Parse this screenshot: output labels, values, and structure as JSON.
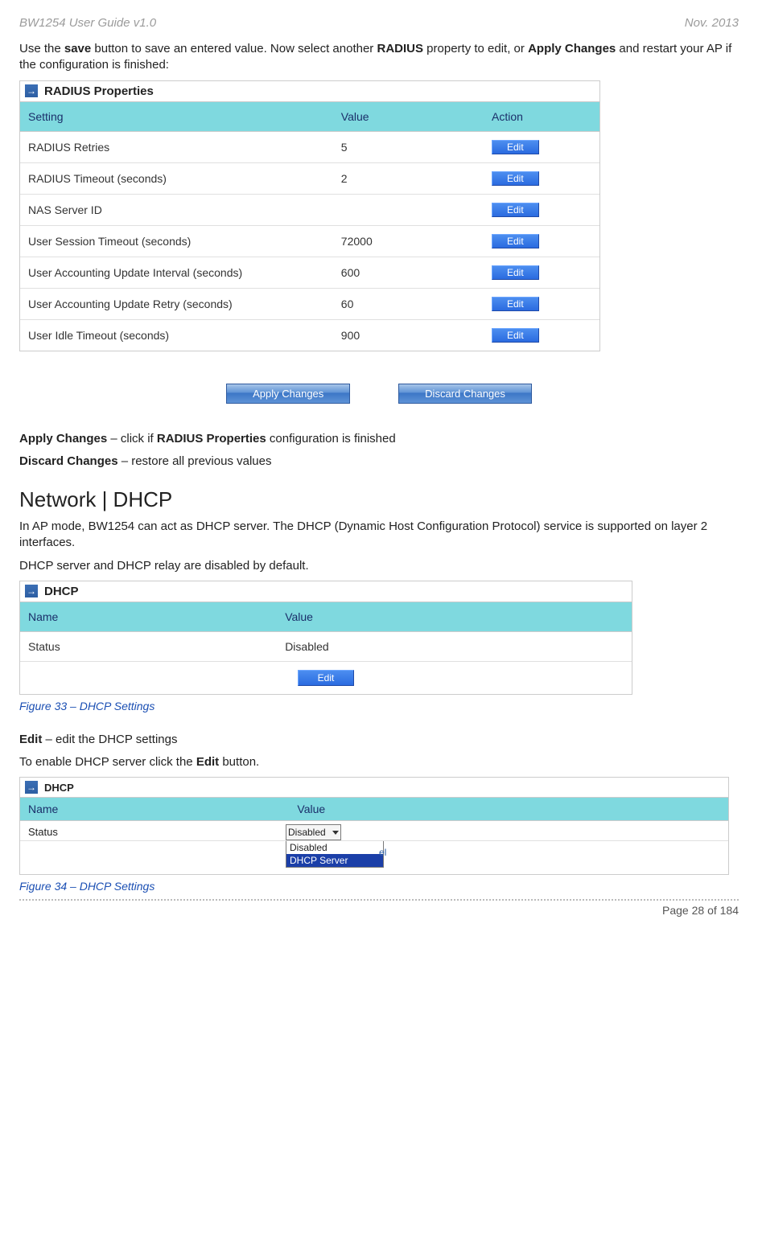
{
  "header": {
    "left": "BW1254 User Guide v1.0",
    "right": "Nov.  2013"
  },
  "intro": {
    "prefix": "Use the ",
    "save": "save",
    "mid1": " button to save an entered value. Now select another ",
    "radius": "RADIUS",
    "mid2": " property to edit, or ",
    "apply": "Apply Changes",
    "tail": " and restart your AP if the configuration is finished:"
  },
  "radius": {
    "title": "RADIUS Properties",
    "cols": {
      "setting": "Setting",
      "value": "Value",
      "action": "Action"
    },
    "edit": "Edit",
    "rows": [
      {
        "setting": "RADIUS Retries",
        "value": "5"
      },
      {
        "setting": "RADIUS Timeout (seconds)",
        "value": "2"
      },
      {
        "setting": "NAS Server ID",
        "value": ""
      },
      {
        "setting": "User Session Timeout (seconds)",
        "value": "72000"
      },
      {
        "setting": "User Accounting Update Interval (seconds)",
        "value": "600"
      },
      {
        "setting": "User Accounting Update Retry (seconds)",
        "value": "60"
      },
      {
        "setting": "User Idle Timeout (seconds)",
        "value": "900"
      }
    ]
  },
  "changes": {
    "apply": "Apply Changes",
    "discard": "Discard Changes"
  },
  "notes": {
    "apply_b": "Apply Changes",
    "apply_t": " – click if ",
    "apply_b2": "RADIUS Properties",
    "apply_t2": " configuration is finished",
    "discard_b": "Discard Changes",
    "discard_t": " – restore all previous values"
  },
  "section": "Network | DHCP",
  "dhcp_intro1": "In AP mode, BW1254 can act as DHCP server. The DHCP (Dynamic Host Configuration Protocol) service is supported on layer 2 interfaces.",
  "dhcp_intro2": "DHCP server and DHCP relay are disabled by default.",
  "dhcp": {
    "title": "DHCP",
    "cols": {
      "name": "Name",
      "value": "Value"
    },
    "status": "Status",
    "status_val": "Disabled",
    "edit": "Edit"
  },
  "fig33": "Figure 33 – DHCP Settings",
  "edit_note_b": "Edit",
  "edit_note_t": " – edit the DHCP settings",
  "enable_text1": "To enable DHCP server click the ",
  "enable_text_b": "Edit",
  "enable_text2": " button.",
  "dhcp2": {
    "title": "DHCP",
    "cols": {
      "name": "Name",
      "value": "Value"
    },
    "status": "Status",
    "selected": "Disabled",
    "options": [
      "Disabled",
      "DHCP Server"
    ],
    "cancel_hint": "el"
  },
  "fig34": "Figure 34 – DHCP Settings",
  "footer": "Page 28 of 184"
}
